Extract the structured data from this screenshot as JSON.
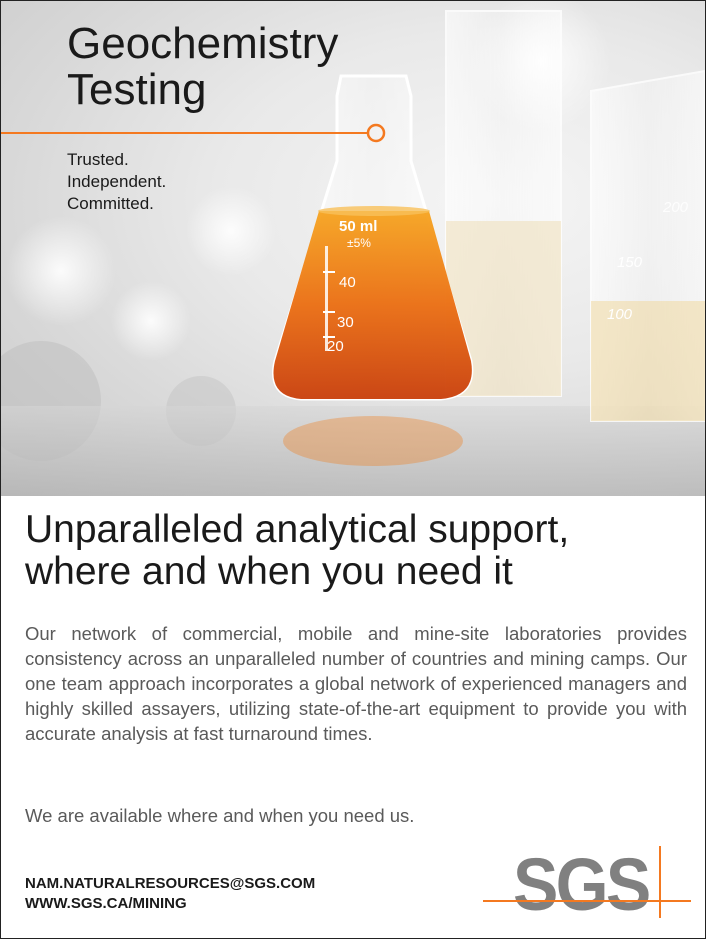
{
  "hero": {
    "title_line1": "Geochemistry",
    "title_line2": "Testing",
    "tagline": [
      "Trusted.",
      "Independent.",
      "Committed."
    ],
    "flask_markings": [
      "50 ml",
      "±5%",
      "40",
      "30",
      "20"
    ],
    "beaker_markings": [
      "200",
      "150",
      "100"
    ]
  },
  "headline": {
    "line1": "Unparalleled analytical support,",
    "line2": "where and when you need it"
  },
  "body": {
    "paragraph": "Our network of commercial, mobile and mine-site laboratories provides consistency across an unparalleled number of countries and mining camps. Our one team approach incorporates a global network of experienced managers and highly skilled assayers, utilizing state-of-the-art equipment to provide you with accurate analysis at fast turnaround times.",
    "closing": "We are available where and when you need us."
  },
  "contact": {
    "email": "NAM.NATURALRESOURCES@SGS.COM",
    "website": "WWW.SGS.CA/MINING"
  },
  "logo": {
    "text": "SGS"
  },
  "colors": {
    "accent": "#f47920",
    "logo_gray": "#808080",
    "text_dark": "#1a1a1a",
    "text_body": "#5a5a5a"
  }
}
